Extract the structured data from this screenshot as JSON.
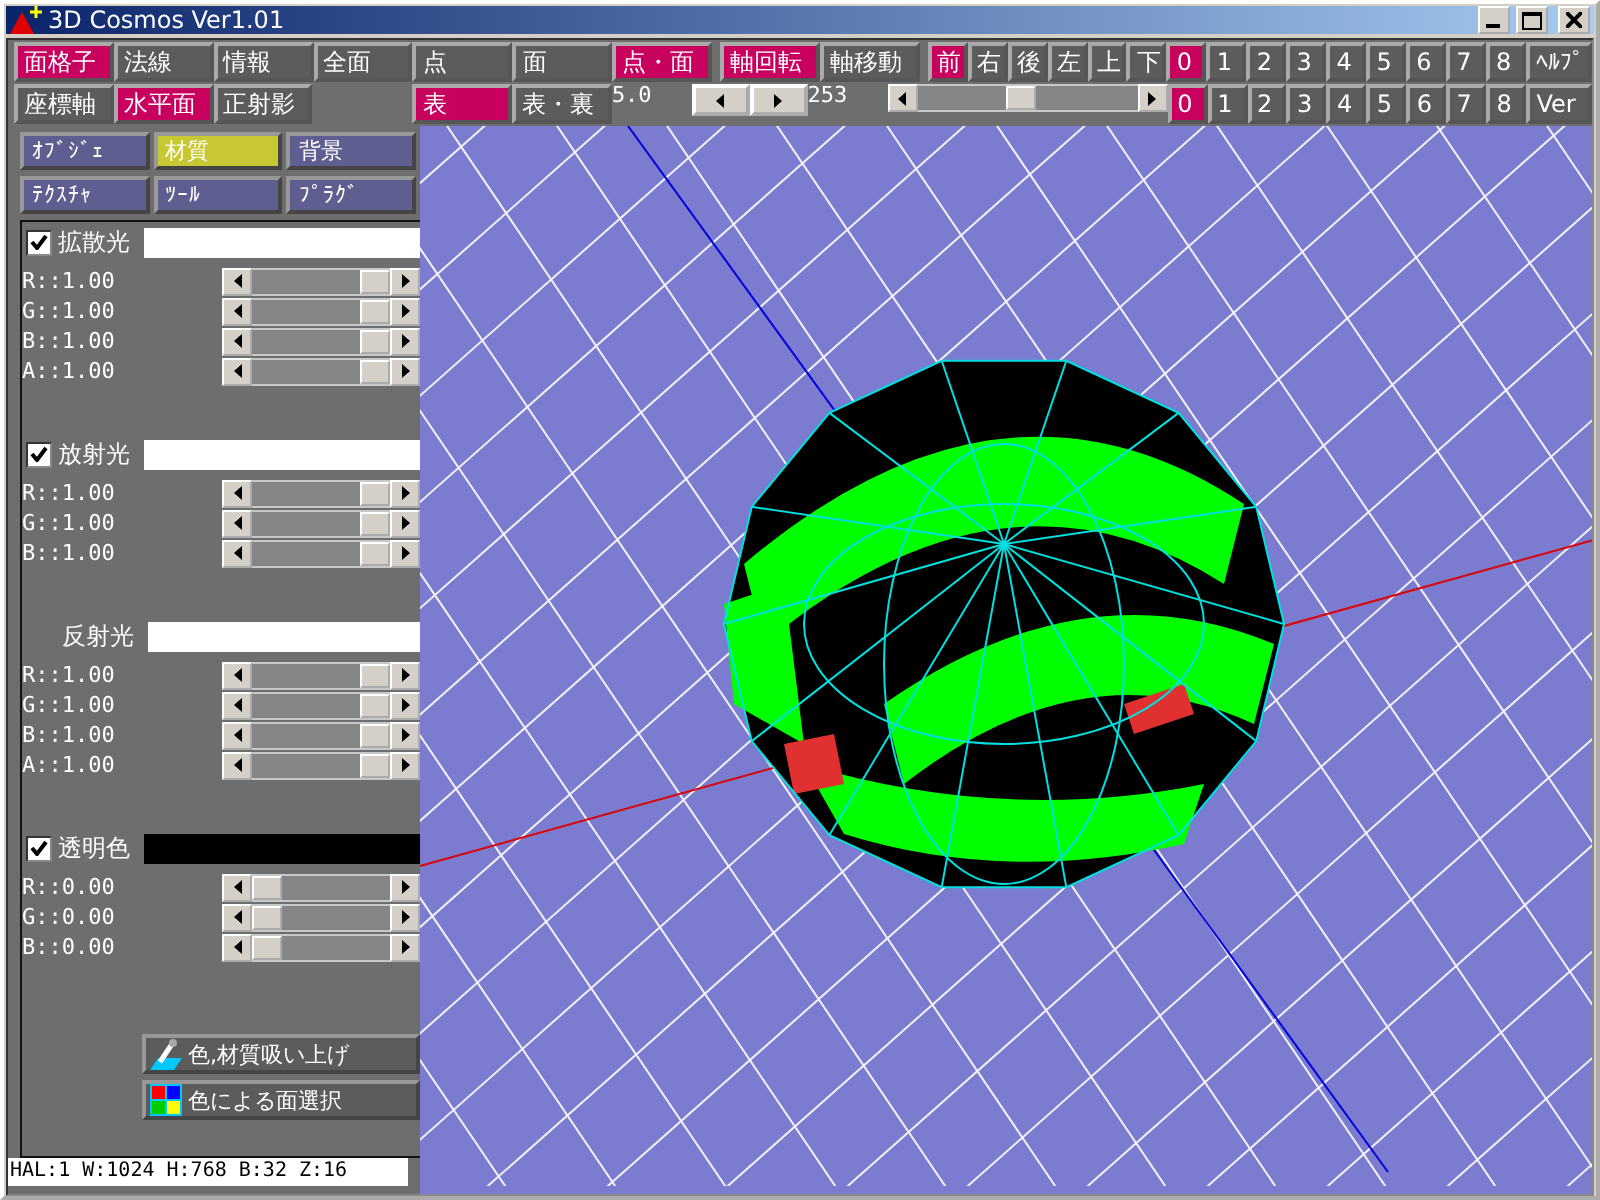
{
  "window": {
    "title": "3D Cosmos Ver1.01"
  },
  "toolbar": {
    "row1": {
      "mode_buttons": [
        {
          "label": "面格子",
          "selected": true
        },
        {
          "label": "法線",
          "selected": false
        },
        {
          "label": "情報",
          "selected": false
        },
        {
          "label": "全面",
          "selected": false
        },
        {
          "label": "点",
          "selected": false
        },
        {
          "label": "面",
          "selected": false
        },
        {
          "label": "点・面",
          "selected": true
        }
      ],
      "axis_buttons": [
        {
          "label": "軸回転",
          "selected": true
        },
        {
          "label": "軸移動",
          "selected": false
        }
      ],
      "view_buttons": [
        {
          "label": "前",
          "selected": true
        },
        {
          "label": "右",
          "selected": false
        },
        {
          "label": "後",
          "selected": false
        },
        {
          "label": "左",
          "selected": false
        },
        {
          "label": "上",
          "selected": false
        },
        {
          "label": "下",
          "selected": false
        }
      ],
      "layer_buttons": [
        {
          "label": "0",
          "selected": true
        },
        {
          "label": "1",
          "selected": false
        },
        {
          "label": "2",
          "selected": false
        },
        {
          "label": "3",
          "selected": false
        },
        {
          "label": "4",
          "selected": false
        },
        {
          "label": "5",
          "selected": false
        },
        {
          "label": "6",
          "selected": false
        },
        {
          "label": "7",
          "selected": false
        },
        {
          "label": "8",
          "selected": false
        }
      ],
      "end_button": "ﾍﾙﾌﾟ"
    },
    "row2": {
      "mode_buttons": [
        {
          "label": "座標軸",
          "selected": false
        },
        {
          "label": "水平面",
          "selected": true
        },
        {
          "label": "正射影",
          "selected": false
        }
      ],
      "face_buttons": [
        {
          "label": "表",
          "selected": true
        },
        {
          "label": "表・裏",
          "selected": false
        }
      ],
      "zoom": {
        "value": "5.0"
      },
      "angle": {
        "value": "253",
        "level": 0.47
      },
      "layer_buttons": [
        {
          "label": "0",
          "selected": true
        },
        {
          "label": "1",
          "selected": false
        },
        {
          "label": "2",
          "selected": false
        },
        {
          "label": "3",
          "selected": false
        },
        {
          "label": "4",
          "selected": false
        },
        {
          "label": "5",
          "selected": false
        },
        {
          "label": "6",
          "selected": false
        },
        {
          "label": "7",
          "selected": false
        },
        {
          "label": "8",
          "selected": false
        }
      ],
      "end_button": "Ver"
    }
  },
  "side_tabs": [
    {
      "label": "ｵﾌﾞｼﾞｪ",
      "selected": false
    },
    {
      "label": "材質",
      "selected": true
    },
    {
      "label": "背景",
      "selected": false
    },
    {
      "label": "ﾃｸｽﾁｬ",
      "selected": false
    },
    {
      "label": "ﾂｰﾙ",
      "selected": false
    },
    {
      "label": "ﾌﾟﾗｸﾞ",
      "selected": false
    }
  ],
  "material_sections": [
    {
      "label": "拡散光",
      "kind": "check",
      "checked": true,
      "color": "#ffffff",
      "channels": [
        {
          "reading": "R::1.00",
          "level": 1
        },
        {
          "reading": "G::1.00",
          "level": 1
        },
        {
          "reading": "B::1.00",
          "level": 1
        },
        {
          "reading": "A::1.00",
          "level": 1
        }
      ]
    },
    {
      "label": "放射光",
      "kind": "check",
      "checked": true,
      "color": "#ffffff",
      "channels": [
        {
          "reading": "R::1.00",
          "level": 1
        },
        {
          "reading": "G::1.00",
          "level": 1
        },
        {
          "reading": "B::1.00",
          "level": 1
        }
      ]
    },
    {
      "label": "反射光",
      "kind": "plain",
      "color": "#ffffff",
      "channels": [
        {
          "reading": "R::1.00",
          "level": 1
        },
        {
          "reading": "G::1.00",
          "level": 1
        },
        {
          "reading": "B::1.00",
          "level": 1
        },
        {
          "reading": "A::1.00",
          "level": 1
        }
      ]
    },
    {
      "label": "透明色",
      "kind": "check",
      "checked": true,
      "color": "#000000",
      "channels": [
        {
          "reading": "R::0.00",
          "level": 0
        },
        {
          "reading": "G::0.00",
          "level": 0
        },
        {
          "reading": "B::0.00",
          "level": 0
        }
      ]
    }
  ],
  "tool_buttons": [
    {
      "label": "色,材質吸い上げ",
      "kind": "dropper"
    },
    {
      "label": "色による面選択",
      "kind": "palette"
    }
  ],
  "status_bar": "HAL:1 W:1024 H:768 B:32 Z:16"
}
